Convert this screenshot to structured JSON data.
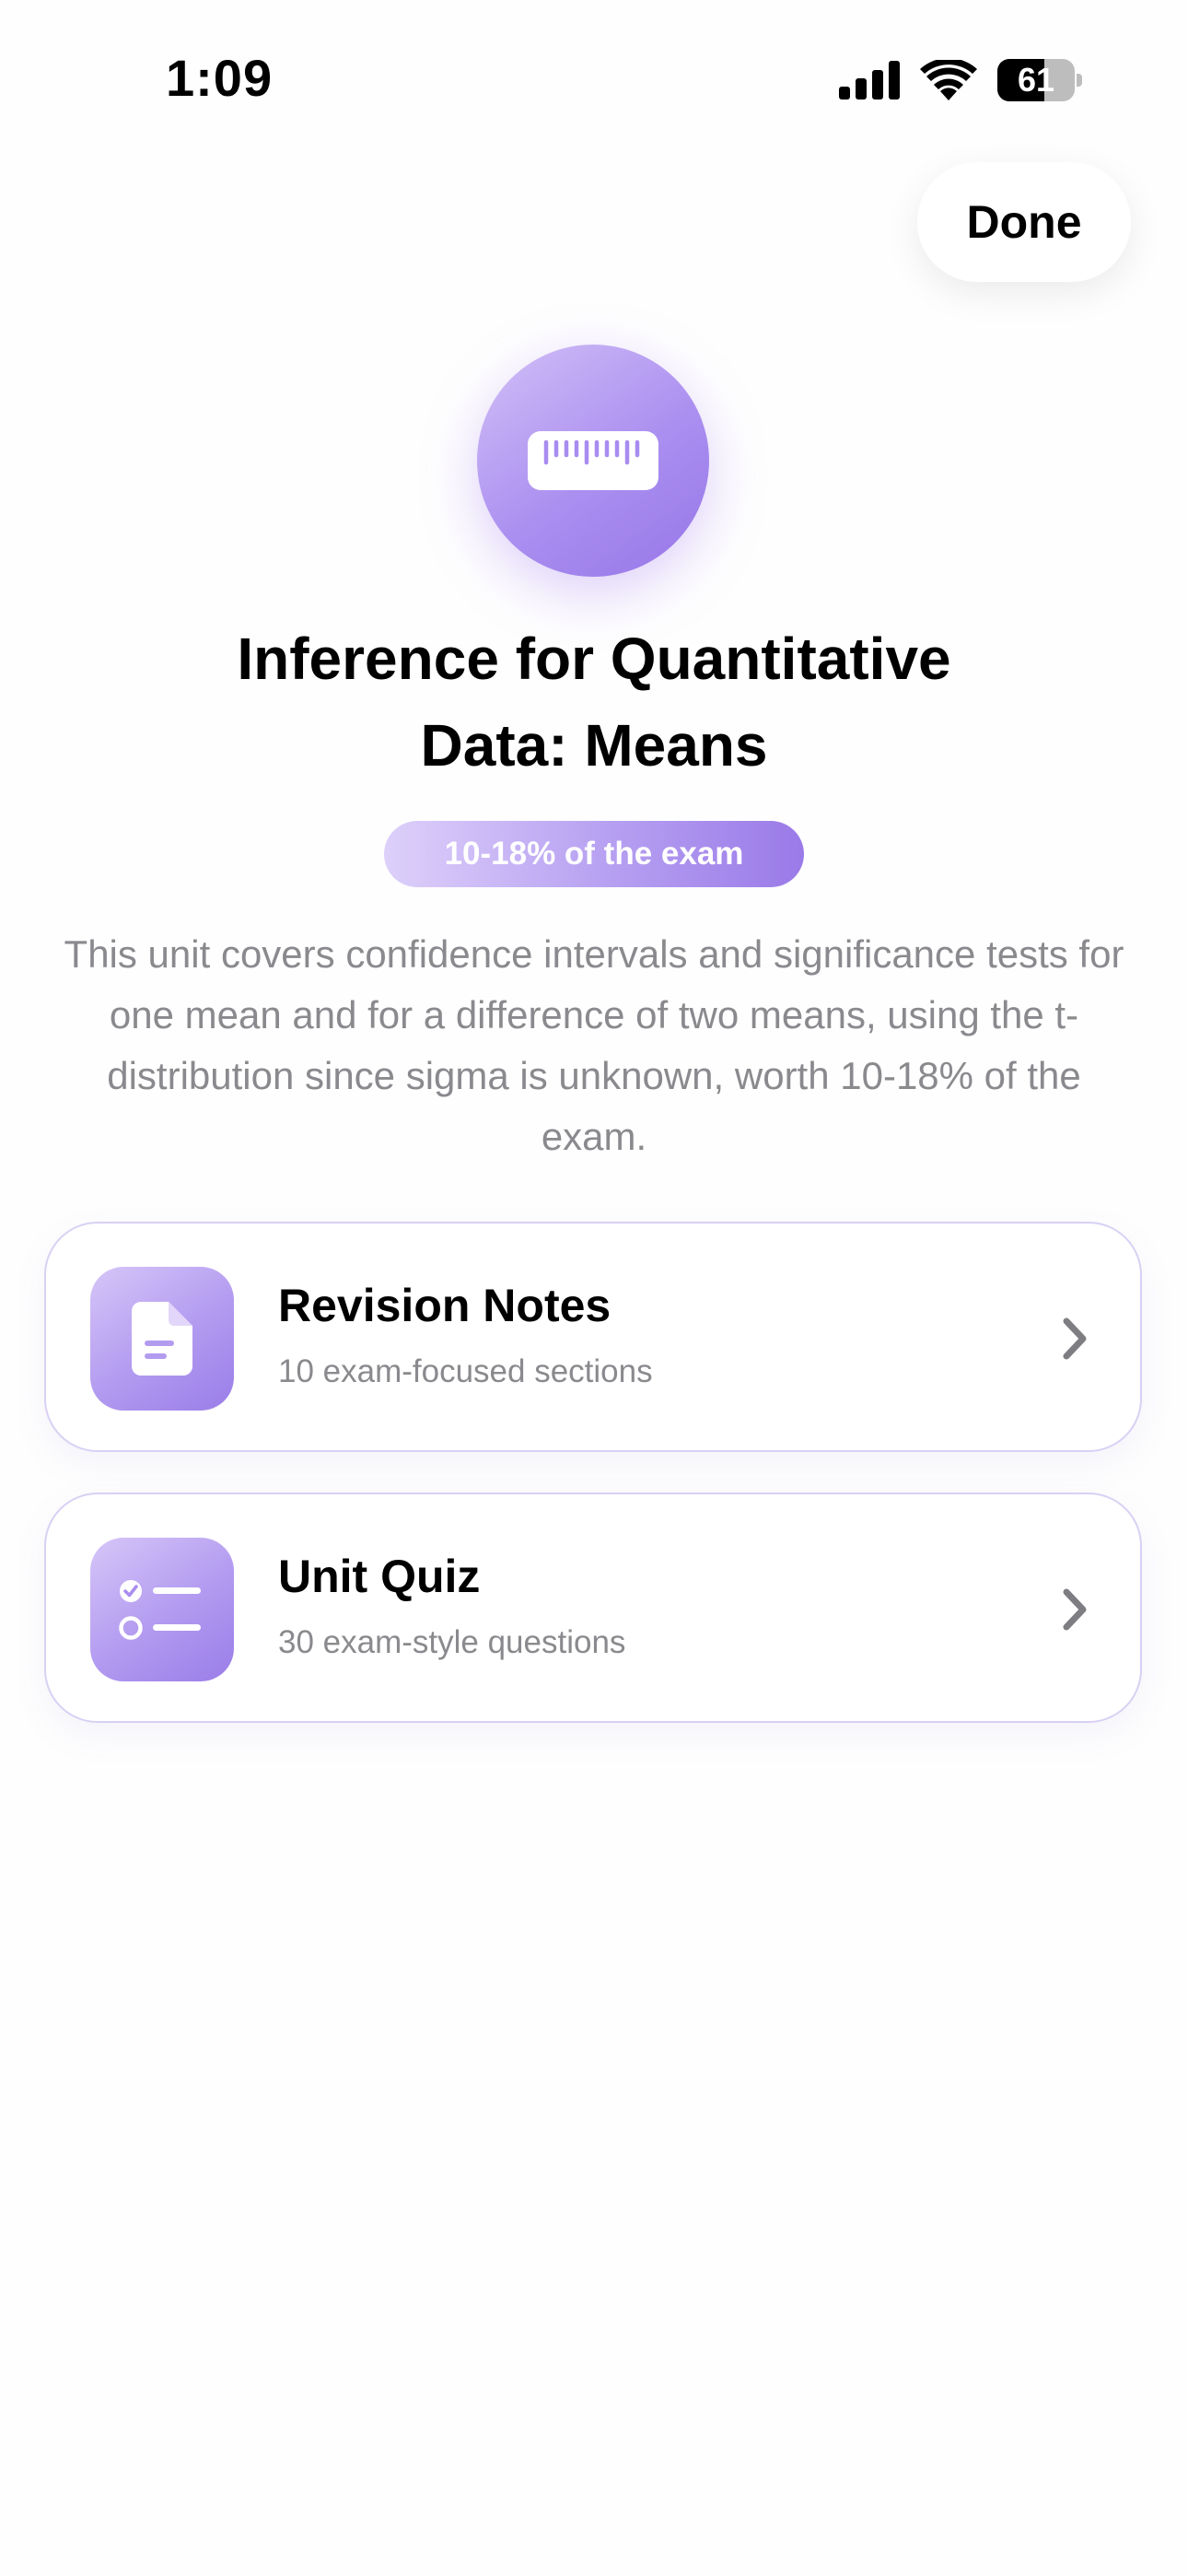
{
  "status_bar": {
    "time": "1:09",
    "battery_percent": 61
  },
  "header": {
    "done_label": "Done"
  },
  "hero": {
    "icon": "ruler-icon",
    "title_line1": "Inference for Quantitative",
    "title_line2": "Data: Means",
    "exam_weight": "10-18% of the exam",
    "description": "This unit covers confidence intervals and significance tests for one mean and for a difference of two means, using the t-distribution since sigma is unknown, worth 10-18% of the exam."
  },
  "options": [
    {
      "title": "Revision Notes",
      "subtitle": "10 exam-focused sections",
      "icon": "document-icon"
    },
    {
      "title": "Unit Quiz",
      "subtitle": "30 exam-style questions",
      "icon": "checklist-icon"
    }
  ],
  "colors": {
    "accent": "#9a7de8",
    "accent_light": "#d6c6f8",
    "secondary_text": "#8a8a8e",
    "card_border": "#d9d0f4"
  }
}
